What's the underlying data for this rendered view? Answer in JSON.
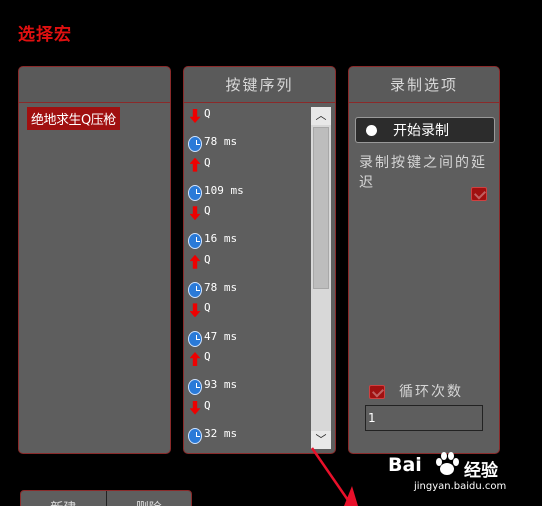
{
  "title": "选择宏",
  "macros_panel": {
    "items": [
      "绝地求生Q压枪"
    ]
  },
  "keys_panel": {
    "header": "按键序列",
    "sequence": [
      {
        "type": "down",
        "text": "Q"
      },
      {
        "type": "delay",
        "text": "78 ms"
      },
      {
        "type": "up",
        "text": "Q"
      },
      {
        "type": "delay",
        "text": "109 ms"
      },
      {
        "type": "down",
        "text": "Q"
      },
      {
        "type": "delay",
        "text": "16 ms"
      },
      {
        "type": "up",
        "text": "Q"
      },
      {
        "type": "delay",
        "text": "78 ms"
      },
      {
        "type": "down",
        "text": "Q"
      },
      {
        "type": "delay",
        "text": "47 ms"
      },
      {
        "type": "up",
        "text": "Q"
      },
      {
        "type": "delay",
        "text": "93 ms"
      },
      {
        "type": "down",
        "text": "Q"
      },
      {
        "type": "delay",
        "text": "32 ms"
      }
    ]
  },
  "options_panel": {
    "header": "录制选项",
    "record_button": "开始录制",
    "delay_label": "录制按键之间的延迟",
    "loop_label": "循环次数",
    "loop_value": "1"
  },
  "bottom_buttons": [
    "新建",
    "删除"
  ],
  "watermark": {
    "logo": "Bai",
    "cn": "经验",
    "url": "jingyan.baidu.com"
  },
  "colors": {
    "title": "#e01010",
    "accent_red": "#a01010",
    "panel_bg": "#5e5e5e",
    "annotation_arrow": "#e8102a"
  }
}
